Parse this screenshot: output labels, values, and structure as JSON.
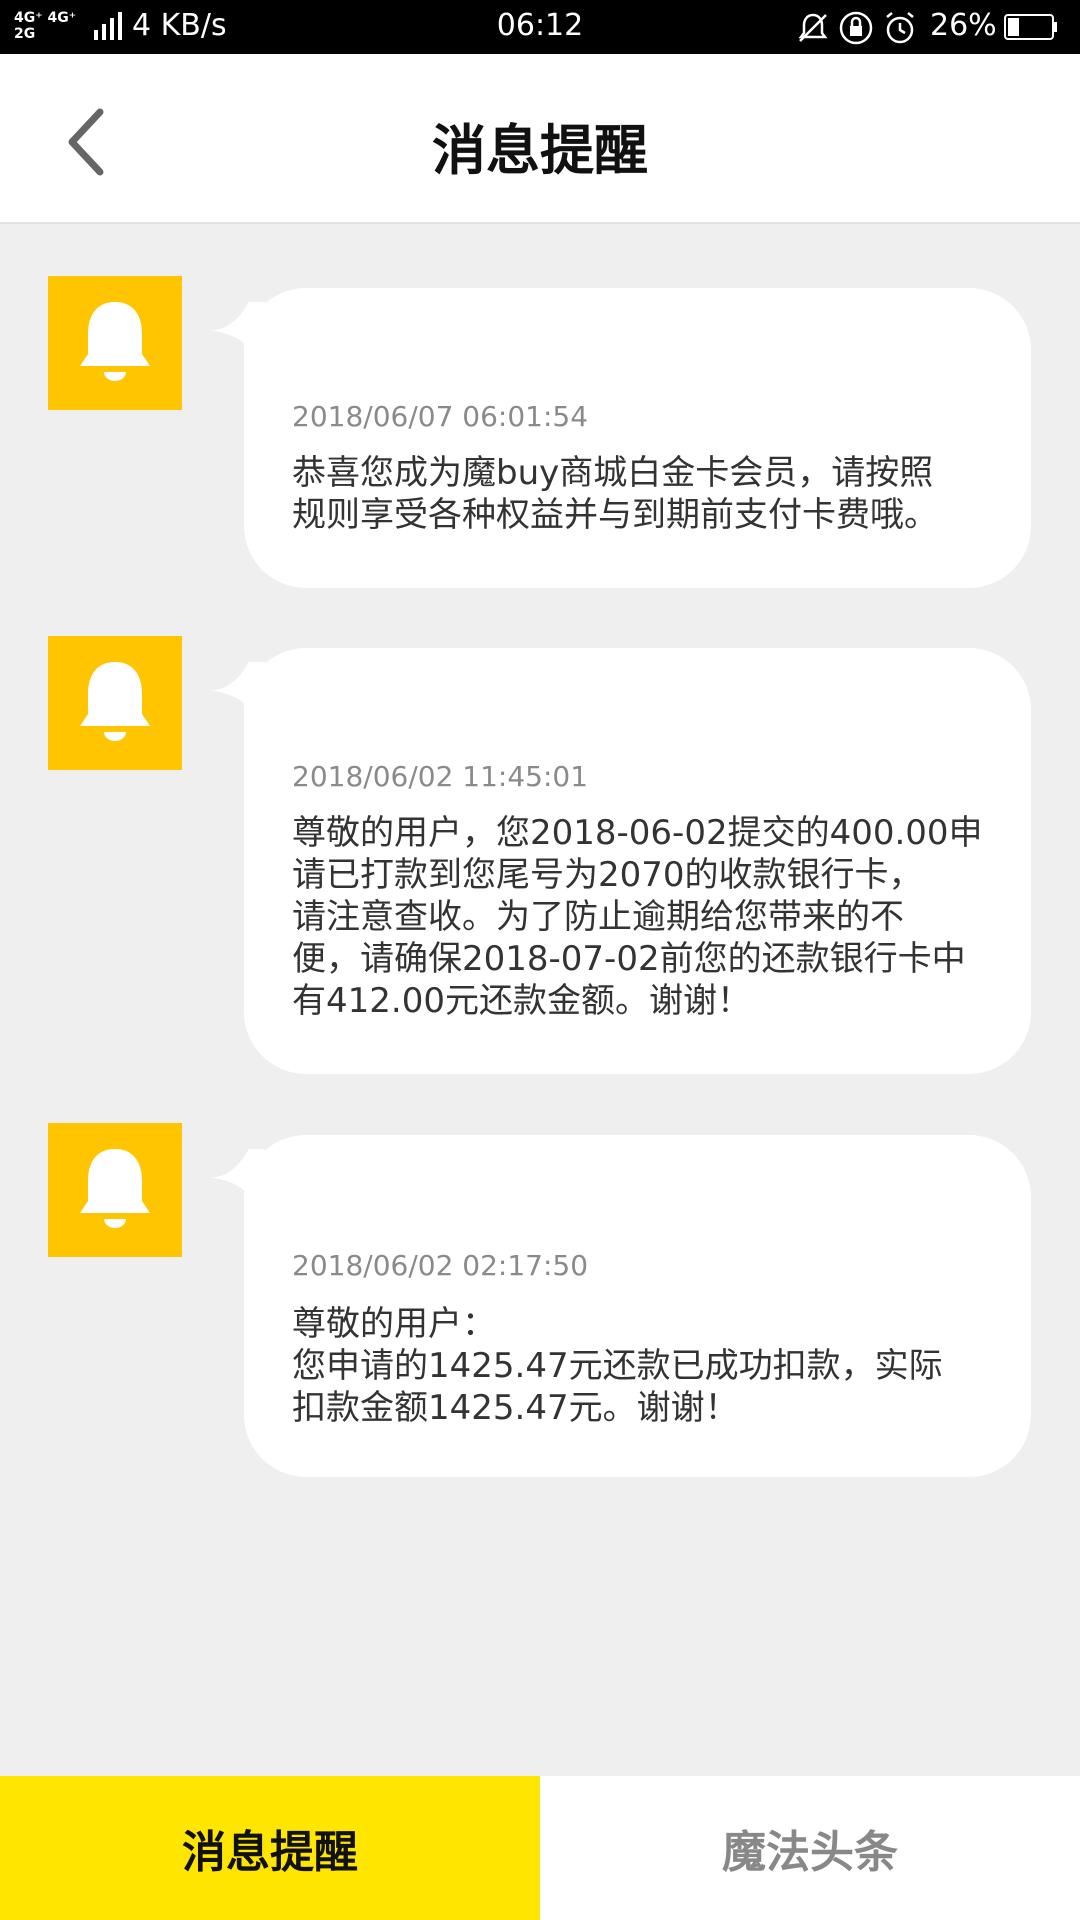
{
  "status_bar": {
    "network_top": "4G⁺ 4G⁺",
    "network_bottom": "2G",
    "speed": "4 KB/s",
    "time": "06:12",
    "battery": "26%",
    "battery_level": 0.26,
    "icons": [
      "bell-off-icon",
      "lock-rotate-icon",
      "alarm-icon",
      "battery-icon"
    ]
  },
  "header": {
    "title": "消息提醒"
  },
  "messages": [
    {
      "time": "2018/06/07 06:01:54",
      "body": "恭喜您成为魔buy商城白金卡会员，请按照\n规则享受各种权益并与到期前支付卡费哦。"
    },
    {
      "time": "2018/06/02 11:45:01",
      "body": "尊敬的用户，您2018-06-02提交的400.00申\n请已打款到您尾号为2070的收款银行卡，\n请注意查收。为了防止逾期给您带来的不\n便，请确保2018-07-02前您的还款银行卡中\n有412.00元还款金额。谢谢！"
    },
    {
      "time": "2018/06/02 02:17:50",
      "body": "尊敬的用户：\n您申请的1425.47元还款已成功扣款，实际\n扣款金额1425.47元。谢谢！"
    }
  ],
  "tabs": [
    {
      "label": "消息提醒",
      "active": true
    },
    {
      "label": "魔法头条",
      "active": false
    }
  ],
  "colors": {
    "accent_yellow": "#ffe600",
    "avatar_yellow": "#ffc500",
    "background": "#efefef"
  }
}
